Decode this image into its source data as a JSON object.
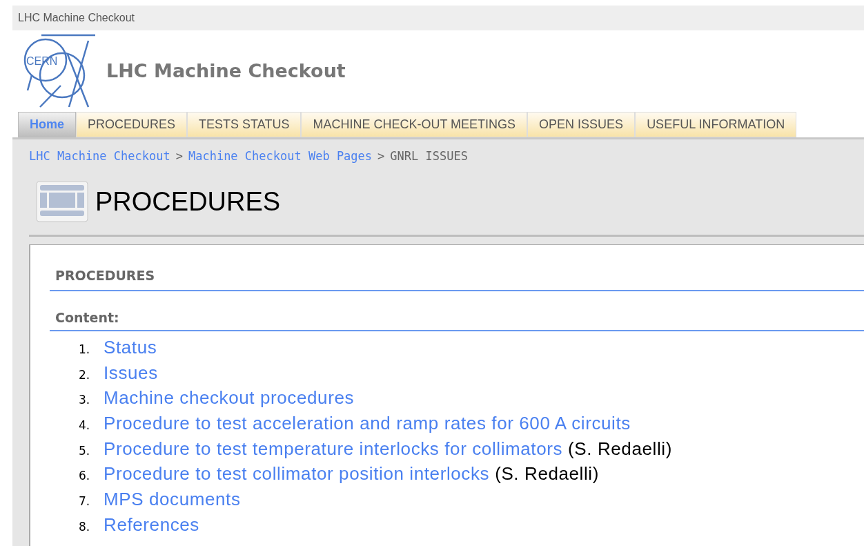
{
  "window": {
    "title": "LHC Machine Checkout"
  },
  "site": {
    "logo_text": "CERN",
    "title": "LHC Machine Checkout"
  },
  "tabs": [
    {
      "label": "Home",
      "selected": true
    },
    {
      "label": "PROCEDURES",
      "selected": false
    },
    {
      "label": "TESTS STATUS",
      "selected": false
    },
    {
      "label": "MACHINE CHECK-OUT MEETINGS",
      "selected": false
    },
    {
      "label": "OPEN ISSUES",
      "selected": false
    },
    {
      "label": "USEFUL INFORMATION",
      "selected": false
    }
  ],
  "breadcrumb": {
    "links": [
      "LHC Machine Checkout",
      "Machine Checkout Web Pages"
    ],
    "separator": ">",
    "current": "GNRL ISSUES"
  },
  "page_title": "PROCEDURES",
  "section": {
    "heading": "PROCEDURES",
    "subheading": "Content:"
  },
  "contents": [
    {
      "number": "1.",
      "link": "Status"
    },
    {
      "number": "2.",
      "link": "Issues"
    },
    {
      "number": "3.",
      "link": "Machine checkout procedures"
    },
    {
      "number": "4.",
      "link": "Procedure to test acceleration and ramp rates for 600 A circuits"
    },
    {
      "number": "5.",
      "link": "Procedure to test temperature interlocks for collimators",
      "note": "(S. Redaelli)"
    },
    {
      "number": "6.",
      "link": "Procedure to test collimator position interlocks",
      "note": "(S. Redaelli)"
    },
    {
      "number": "7.",
      "link": "MPS documents"
    },
    {
      "number": "8.",
      "link": "References"
    }
  ]
}
